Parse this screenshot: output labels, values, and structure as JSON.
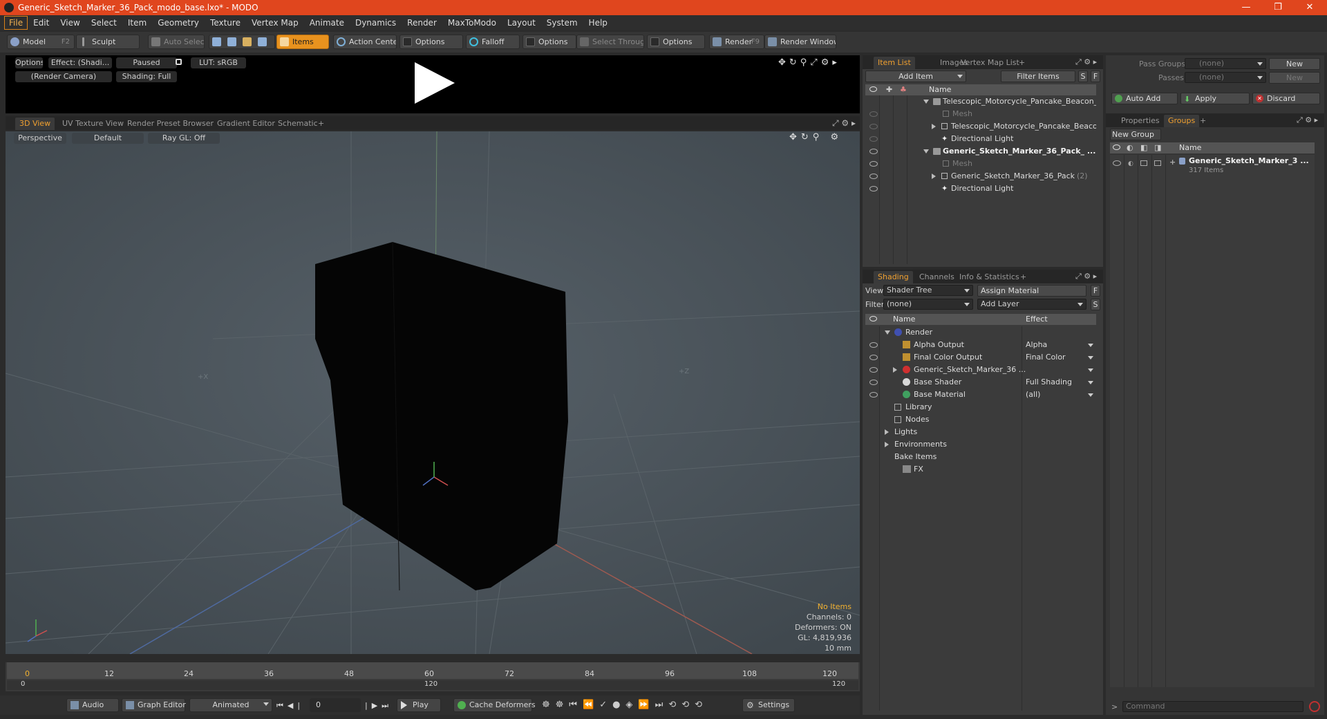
{
  "window": {
    "title": "Generic_Sketch_Marker_36_Pack_modo_base.lxo* - MODO",
    "controls": [
      "—",
      "❐",
      "✕"
    ]
  },
  "menu": [
    "File",
    "Edit",
    "View",
    "Select",
    "Item",
    "Geometry",
    "Texture",
    "Vertex Map",
    "Animate",
    "Dynamics",
    "Render",
    "MaxToModo",
    "Layout",
    "System",
    "Help"
  ],
  "toolbar": {
    "model": "Model",
    "model_key": "F2",
    "sculpt": "Sculpt",
    "auto_select": "Auto Select",
    "items": "Items",
    "action_center": "Action Center",
    "options1": "Options",
    "falloff": "Falloff",
    "options2": "Options",
    "select_through": "Select Through",
    "options3": "Options",
    "render": "Render",
    "render_key": "F9",
    "render_window": "Render Window"
  },
  "preview": {
    "options": "Options",
    "effect": "Effect: (Shadi...",
    "paused": "Paused",
    "lut": "LUT: sRGB",
    "camera": "(Render Camera)",
    "shading": "Shading: Full"
  },
  "view_tabs": [
    "3D View",
    "UV Texture View",
    "Render Preset Browser",
    "Gradient Editor",
    "Schematic",
    "+"
  ],
  "viewport": {
    "perspective": "Perspective",
    "default": "Default",
    "raygl": "Ray GL: Off",
    "axis_x": "+X",
    "axis_z": "+Z",
    "hud": {
      "no_items": "No Items",
      "channels": "Channels: 0",
      "deformers": "Deformers: ON",
      "gl": "GL: 4,819,936",
      "scale": "10 mm"
    }
  },
  "timeline": {
    "ticks": [
      "0",
      "12",
      "24",
      "36",
      "48",
      "60",
      "72",
      "84",
      "96",
      "108",
      "120"
    ],
    "range_start": "0",
    "range_mid": "120",
    "range_end": "120"
  },
  "bottom": {
    "audio": "Audio",
    "graph_editor": "Graph Editor",
    "animated": "Animated",
    "frame": "0",
    "play": "Play",
    "cache_deformers": "Cache Deformers",
    "settings": "Settings"
  },
  "item_list": {
    "tabs": [
      "Item List",
      "Images",
      "Vertex Map List",
      "+"
    ],
    "add_item": "Add Item",
    "filter_items": "Filter Items",
    "s": "S",
    "f": "F",
    "col_name": "Name",
    "rows": [
      {
        "label": "Telescopic_Motorcycle_Pancake_Beacon_ ...",
        "style": "normal"
      },
      {
        "label": "Mesh",
        "style": "dim"
      },
      {
        "label": "Telescopic_Motorcycle_Pancake_Beaco ...",
        "style": "normal"
      },
      {
        "label": "Directional Light",
        "style": "normal"
      },
      {
        "label": "Generic_Sketch_Marker_36_Pack_ ...",
        "style": "bold"
      },
      {
        "label": "Mesh",
        "style": "dim"
      },
      {
        "label": "Generic_Sketch_Marker_36_Pack",
        "count": "(2)",
        "style": "normal"
      },
      {
        "label": "Directional Light",
        "style": "normal"
      }
    ]
  },
  "shading": {
    "tabs": [
      "Shading",
      "Channels",
      "Info & Statistics",
      "+"
    ],
    "view_label": "View",
    "view_value": "Shader Tree",
    "assign_material": "Assign Material",
    "f": "F",
    "filter_label": "Filter",
    "filter_value": "(none)",
    "add_layer": "Add Layer",
    "s": "S",
    "col_name": "Name",
    "col_effect": "Effect",
    "rows": [
      {
        "label": "Render",
        "effect": ""
      },
      {
        "label": "Alpha Output",
        "effect": "Alpha"
      },
      {
        "label": "Final Color Output",
        "effect": "Final Color"
      },
      {
        "label": "Generic_Sketch_Marker_36 ...",
        "effect": ""
      },
      {
        "label": "Base Shader",
        "effect": "Full Shading"
      },
      {
        "label": "Base Material",
        "effect": "(all)"
      },
      {
        "label": "Library",
        "effect": ""
      },
      {
        "label": "Nodes",
        "effect": ""
      },
      {
        "label": "Lights",
        "effect": ""
      },
      {
        "label": "Environments",
        "effect": ""
      },
      {
        "label": "Bake Items",
        "effect": ""
      },
      {
        "label": "FX",
        "effect": ""
      }
    ]
  },
  "groups_panel": {
    "pass_groups_label": "Pass Groups",
    "pass_groups_value": "(none)",
    "passes_label": "Passes",
    "passes_value": "(none)",
    "new1": "New",
    "new2": "New",
    "auto_add": "Auto Add",
    "apply": "Apply",
    "discard": "Discard",
    "tabs": [
      "Properties",
      "Groups",
      "+"
    ],
    "new_group": "New Group",
    "col_name": "Name",
    "group_name": "Generic_Sketch_Marker_3 ...",
    "group_count": "317 Items",
    "command_placeholder": "Command"
  },
  "colors": {
    "accent": "#e0461e",
    "orange": "#e8921e",
    "highlight_text": "#f0a030"
  }
}
